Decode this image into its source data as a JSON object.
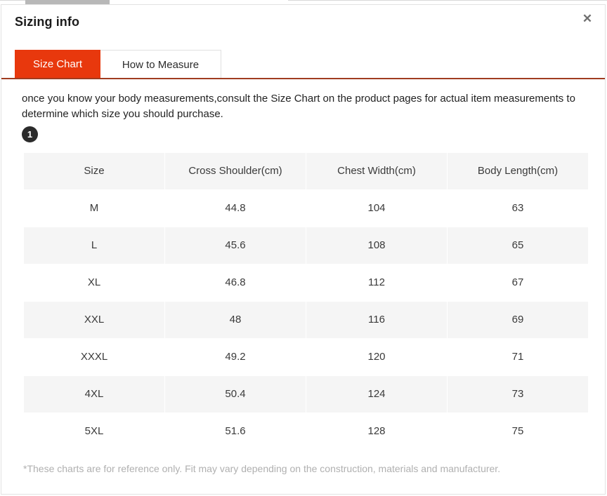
{
  "modal": {
    "title": "Sizing info",
    "close_label": "✕",
    "close_icon": "close-icon"
  },
  "tabs": [
    {
      "label": "Size Chart",
      "active": true
    },
    {
      "label": "How to Measure",
      "active": false
    }
  ],
  "intro": {
    "text": "once you know your body measurements,consult the Size Chart on the product pages for actual item measurements to determine which size you should purchase.",
    "badge": "1"
  },
  "table": {
    "headers": [
      "Size",
      "Cross Shoulder(cm)",
      "Chest Width(cm)",
      "Body Length(cm)"
    ],
    "rows": [
      {
        "cells": [
          "M",
          "44.8",
          "104",
          "63"
        ],
        "shaded": false
      },
      {
        "cells": [
          "L",
          "45.6",
          "108",
          "65"
        ],
        "shaded": true
      },
      {
        "cells": [
          "XL",
          "46.8",
          "112",
          "67"
        ],
        "shaded": false
      },
      {
        "cells": [
          "XXL",
          "48",
          "116",
          "69"
        ],
        "shaded": true
      },
      {
        "cells": [
          "XXXL",
          "49.2",
          "120",
          "71"
        ],
        "shaded": false
      },
      {
        "cells": [
          "4XL",
          "50.4",
          "124",
          "73"
        ],
        "shaded": true
      },
      {
        "cells": [
          "5XL",
          "51.6",
          "128",
          "75"
        ],
        "shaded": false
      }
    ]
  },
  "footnote": "*These charts are for reference only. Fit may vary depending on the construction, materials and manufacturer.",
  "colors": {
    "accent": "#e8380d",
    "rule": "#a03c20",
    "row_shade": "#f5f5f5",
    "badge": "#2b2b2b",
    "footnote_text": "#b0b0b0"
  }
}
